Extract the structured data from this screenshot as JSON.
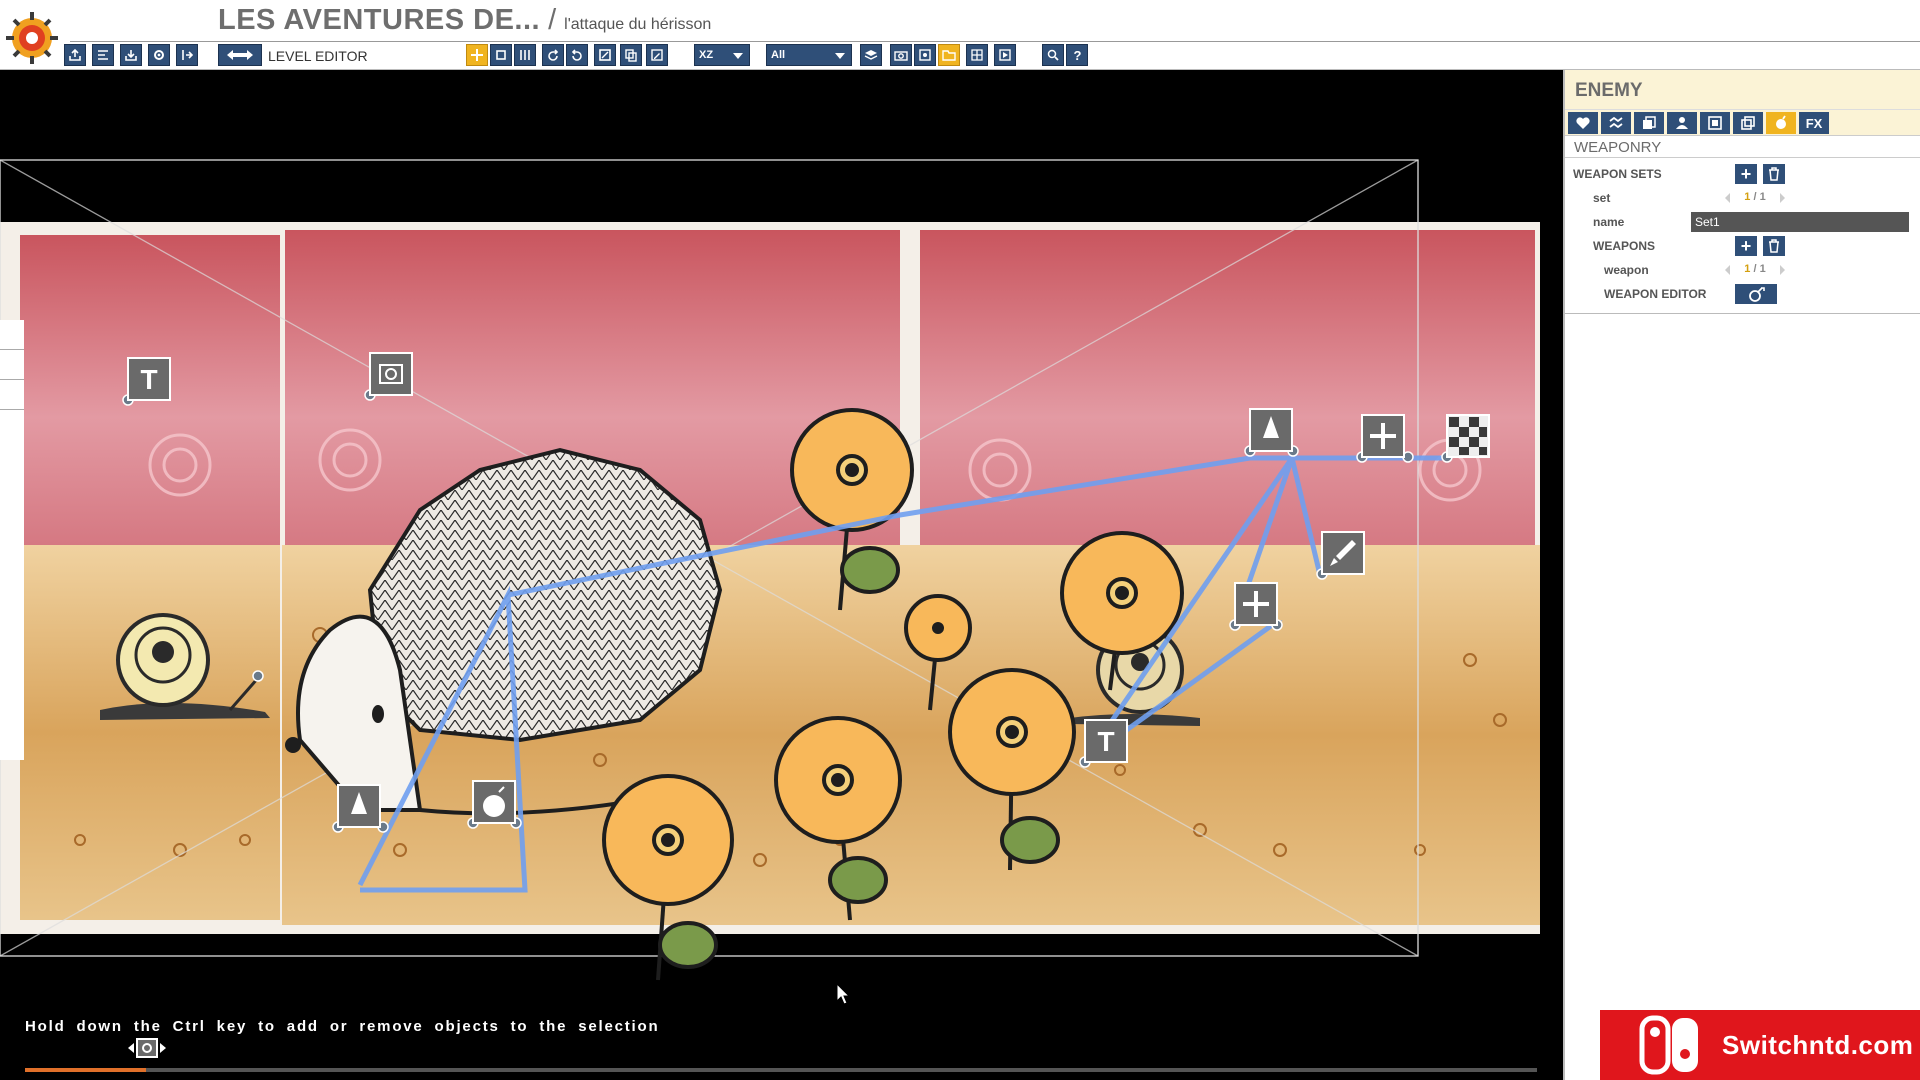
{
  "header": {
    "project_title": "LES AVENTURES DE...",
    "separator": "/",
    "level_name": "l'attaque du hérisson",
    "mode_label": "LEVEL EDITOR"
  },
  "toolbar": {
    "file_buttons": [
      "export-icon",
      "import-list-icon",
      "download-icon",
      "settings-icon",
      "exit-icon"
    ],
    "mode_swap_icon": "swap-arrows-icon",
    "tool_buttons": [
      "move-icon",
      "rotate-icon",
      "scale-icon",
      "undo-icon",
      "redo-icon",
      "frame-icon",
      "copy-icon",
      "edit-icon"
    ],
    "axis_select": "XZ",
    "filter_select": "All",
    "view_buttons": [
      "layers-icon",
      "camera-icon",
      "screenshot-icon",
      "folder-icon",
      "grid-icon",
      "play-icon"
    ],
    "help_buttons": [
      "preview-icon",
      "help-icon"
    ]
  },
  "viewport": {
    "hint": "Hold down the Ctrl key to add or remove objects to the selection",
    "timeline_progress": 0.08
  },
  "panel": {
    "title": "ENEMY",
    "tabs": [
      "heart-icon",
      "zigzag-icon",
      "layers-icon",
      "character-icon",
      "frame-icon",
      "clone-icon",
      "weapon-icon",
      "FX"
    ],
    "active_tab": 6,
    "section": "WEAPONRY",
    "weapon_sets_label": "WEAPON SETS",
    "set_label": "set",
    "set_current": "1",
    "set_total": "1",
    "name_label": "name",
    "name_value": "Set1",
    "weapons_label": "WEAPONS",
    "weapon_label": "weapon",
    "weapon_current": "1",
    "weapon_total": "1",
    "weapon_editor_label": "WEAPON EDITOR",
    "slash": "/"
  },
  "watermark": {
    "text": "Switchntd.com"
  },
  "colors": {
    "toolbar_blue": "#2f4f78",
    "accent_yellow": "#f0b420",
    "panel_header_bg": "#fbf3d6",
    "watermark_red": "#e0161c",
    "path_blue": "#6f9ff0"
  }
}
